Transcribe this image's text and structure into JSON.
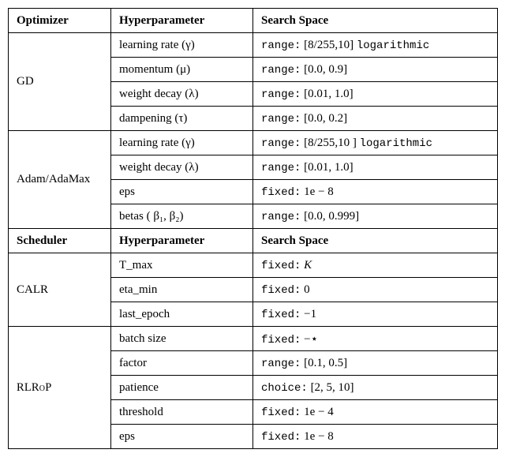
{
  "headers_main": {
    "c1": "Optimizer",
    "c2": "Hyperparameter",
    "c3": "Search Space"
  },
  "headers_sched": {
    "c1": "Scheduler",
    "c2": "Hyperparameter",
    "c3": "Search Space"
  },
  "gd": {
    "label": "GD",
    "r0": {
      "param": "learning rate (γ)",
      "space_pre": "range:",
      "space_mid": " [8/255,10] ",
      "space_suf": "logarithmic"
    },
    "r1": {
      "param": "momentum (μ)",
      "space_pre": "range:",
      "space_mid": " [0.0, 0.9]",
      "space_suf": ""
    },
    "r2": {
      "param": "weight decay (λ)",
      "space_pre": "range:",
      "space_mid": " [0.01, 1.0]",
      "space_suf": ""
    },
    "r3": {
      "param": "dampening (τ)",
      "space_pre": "range:",
      "space_mid": " [0.0, 0.2]",
      "space_suf": ""
    }
  },
  "adam": {
    "label": "Adam/AdaMax",
    "r0": {
      "param": "learning rate (γ)",
      "space_pre": "range:",
      "space_mid": " [8/255,10 ] ",
      "space_suf": "logarithmic"
    },
    "r1": {
      "param": "weight decay (λ)",
      "space_pre": "range:",
      "space_mid": " [0.01, 1.0]",
      "space_suf": ""
    },
    "r2": {
      "param": "eps",
      "space_pre": "fixed:",
      "space_mid": " 1e − 8",
      "space_suf": ""
    },
    "r3": {
      "param": "betas ( β₁, β₂)",
      "space_pre": "range:",
      "space_mid": " [0.0, 0.999]",
      "space_suf": ""
    }
  },
  "calr": {
    "label": "CALR",
    "r0": {
      "param": "T_max",
      "space_pre": "fixed:",
      "space_mid": " K",
      "space_suf": ""
    },
    "r1": {
      "param": "eta_min",
      "space_pre": "fixed:",
      "space_mid": " 0",
      "space_suf": ""
    },
    "r2": {
      "param": "last_epoch",
      "space_pre": "fixed:",
      "space_mid": " −1",
      "space_suf": ""
    }
  },
  "rlrop": {
    "label": "RLRoP",
    "r0": {
      "param": "batch size",
      "space_pre": "fixed:",
      "space_mid": " −⋆",
      "space_suf": ""
    },
    "r1": {
      "param": "factor",
      "space_pre": "range:",
      "space_mid": " [0.1, 0.5]",
      "space_suf": ""
    },
    "r2": {
      "param": "patience",
      "space_pre": "choice:",
      "space_mid": " [2, 5, 10]",
      "space_suf": ""
    },
    "r3": {
      "param": "threshold",
      "space_pre": "fixed:",
      "space_mid": " 1e − 4",
      "space_suf": ""
    },
    "r4": {
      "param": "eps",
      "space_pre": "fixed:",
      "space_mid": " 1e − 8",
      "space_suf": ""
    }
  }
}
